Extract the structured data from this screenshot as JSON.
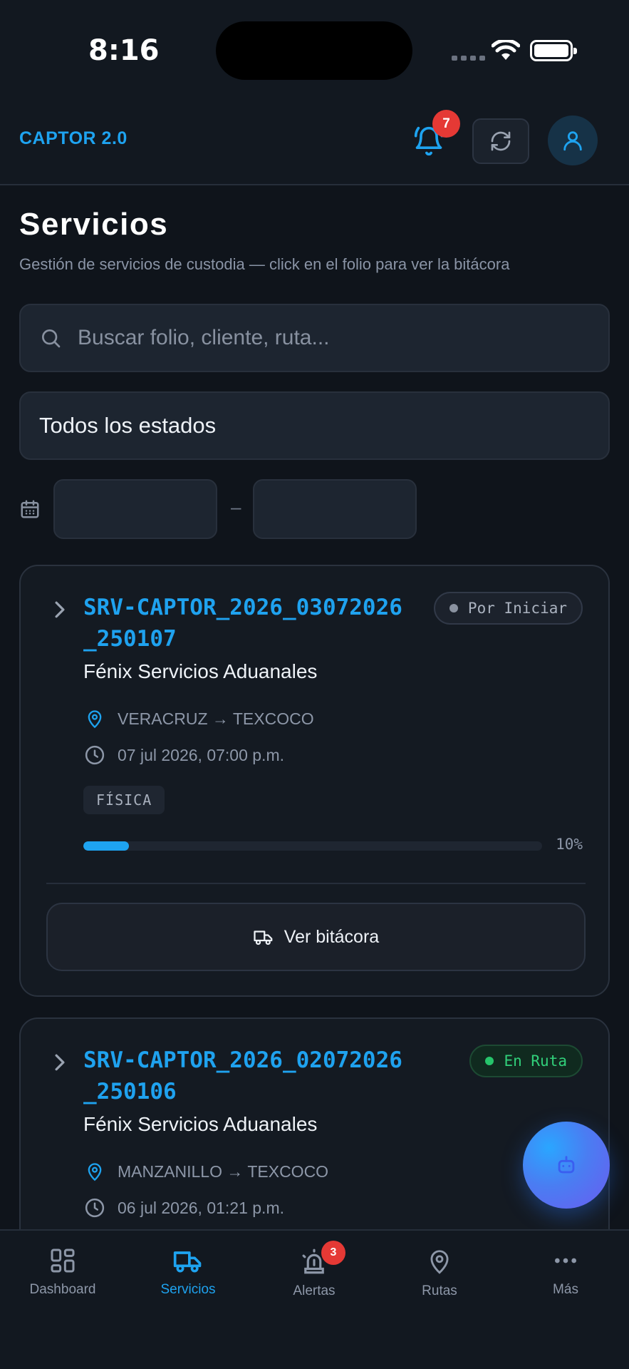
{
  "status_bar": {
    "time": "8:16"
  },
  "header": {
    "brand": "CAPTOR 2.0",
    "notification_count": "7"
  },
  "page": {
    "title": "Servicios",
    "subtitle": "Gestión de servicios de custodia — click en el folio para ver la bitácora"
  },
  "filters": {
    "search_placeholder": "Buscar folio, cliente, ruta...",
    "status_selected": "Todos los estados",
    "date_separator": "–"
  },
  "services": [
    {
      "folio": "SRV-CAPTOR_2026_03072026_250107",
      "status": "Por Iniciar",
      "client": "Fénix Servicios Aduanales",
      "route": "VERACRUZ → TEXCOCO",
      "datetime": "07 jul 2026, 07:00 p.m.",
      "type": "FÍSICA",
      "progress": 0.1,
      "progress_label": "10%",
      "action_label": "Ver bitácora"
    },
    {
      "folio": "SRV-CAPTOR_2026_02072026_250106",
      "status": "En Ruta",
      "client": "Fénix Servicios Aduanales",
      "route": "MANZANILLO → TEXCOCO",
      "datetime": "06 jul 2026, 01:21 p.m."
    }
  ],
  "nav": {
    "items": [
      {
        "label": "Dashboard",
        "icon": "grid-icon",
        "active": false
      },
      {
        "label": "Servicios",
        "icon": "truck-icon",
        "active": true
      },
      {
        "label": "Alertas",
        "icon": "siren-icon",
        "active": false,
        "badge": "3"
      },
      {
        "label": "Rutas",
        "icon": "map-pin-icon",
        "active": false
      },
      {
        "label": "Más",
        "icon": "more-icon",
        "active": false
      }
    ]
  },
  "colors": {
    "accent": "#1ea3f0",
    "background": "#0f141b",
    "card": "#141a22",
    "danger": "#e53935",
    "success": "#31d07a"
  }
}
